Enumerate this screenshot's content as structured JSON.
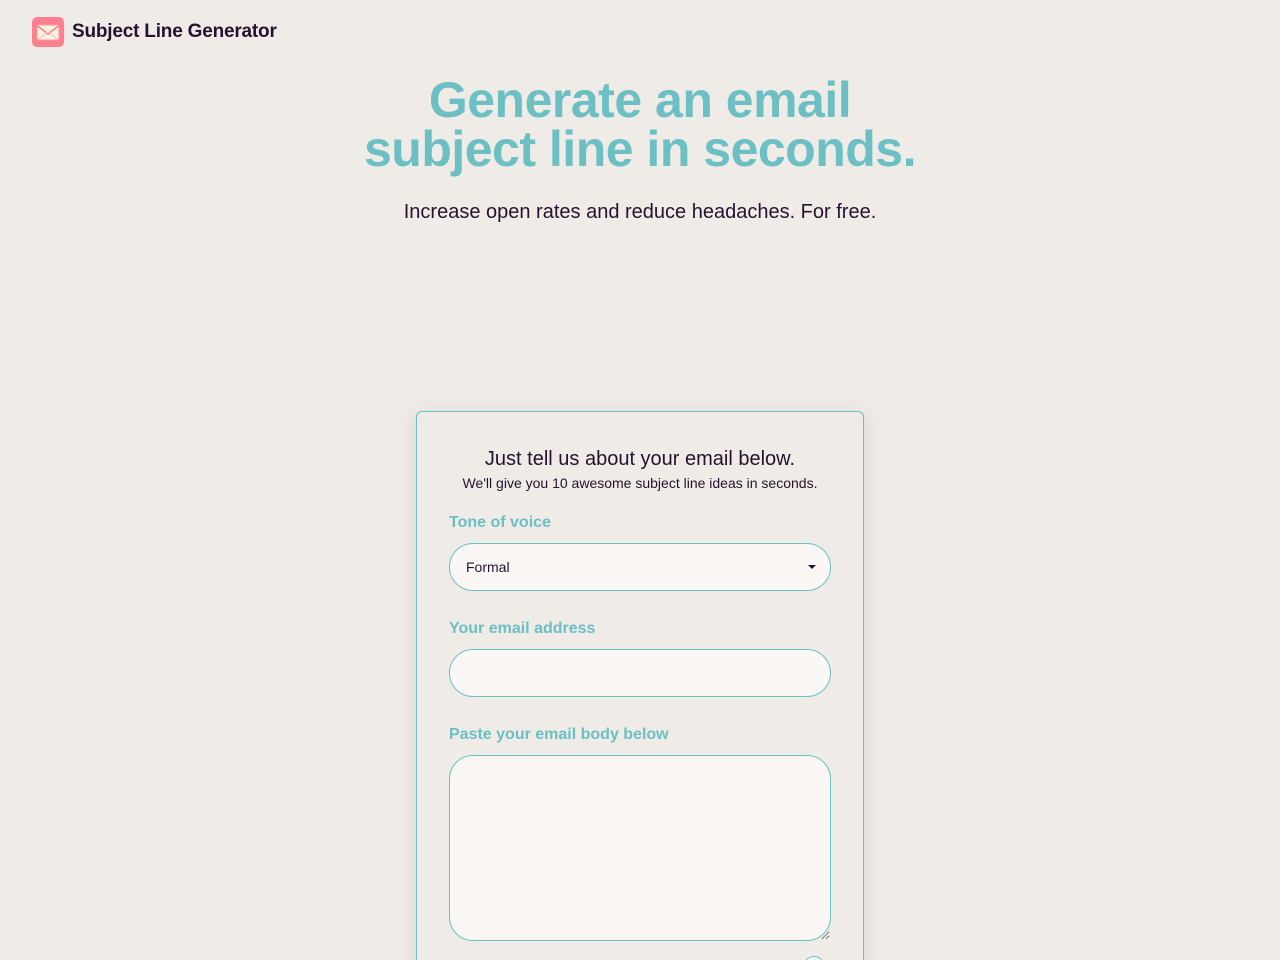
{
  "header": {
    "brand": "Subject Line Generator",
    "logo_icon": "envelope-icon"
  },
  "hero": {
    "title_line1": "Generate an email",
    "title_line2": "subject line in seconds.",
    "subtitle": "Increase open rates and reduce headaches. For free."
  },
  "form": {
    "heading": "Just tell us about your email below.",
    "subheading": "We'll give you 10 awesome subject line ideas in seconds.",
    "tone_label": "Tone of voice",
    "tone_value": "Formal",
    "email_label": "Your email address",
    "email_value": "",
    "body_label": "Paste your email body below",
    "body_value": ""
  },
  "colors": {
    "background": "#efebe7",
    "accent": "#6cc0c4",
    "text": "#24122f",
    "logo": "#ff7f8e",
    "field_fill": "#faf7f4"
  }
}
